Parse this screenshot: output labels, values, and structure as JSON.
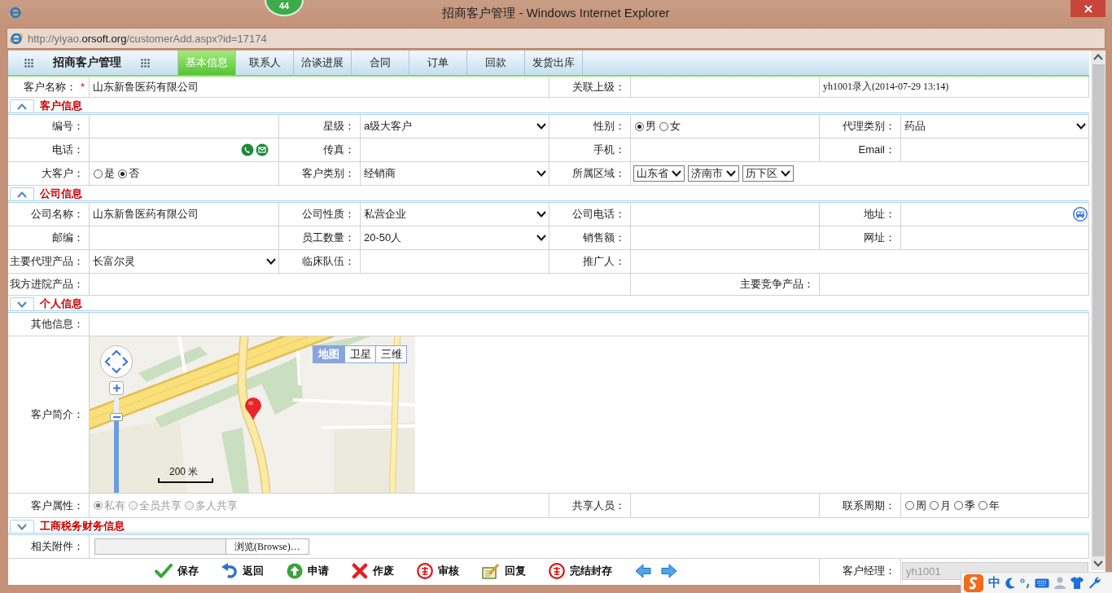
{
  "window": {
    "title": "招商客户管理 - Windows Internet Explorer",
    "badge": "44"
  },
  "address_bar": {
    "url": "http://yiyao.**orsoft.org**/customerAdd.aspx?id=17174"
  },
  "app_bar": {
    "title": "招商客户管理",
    "tabs": [
      {
        "label": "基本信息",
        "selected": true
      },
      {
        "label": "联系人",
        "selected": false
      },
      {
        "label": "洽谈进展",
        "selected": false
      },
      {
        "label": "合同",
        "selected": false
      },
      {
        "label": "订单",
        "selected": false
      },
      {
        "label": "回款",
        "selected": false
      },
      {
        "label": "发货出库",
        "selected": false
      }
    ]
  },
  "form": [
    {
      "kind": "headline",
      "cells": [
        {
          "kind": "label",
          "text": "客户名称：",
          "mark": "*"
        },
        {
          "kind": "text",
          "value": "山东新鲁医药有限公司"
        },
        {
          "kind": "label",
          "text": "关联上级："
        },
        {
          "kind": "text"
        },
        {
          "kind": "note",
          "text": "yh1001录入(2014-07-29 13:14)"
        }
      ]
    },
    {
      "kind": "section",
      "title": "客户信息",
      "expanded": true
    },
    {
      "kind": "standard",
      "cells": [
        {
          "kind": "label",
          "text": "编号："
        },
        {
          "kind": "text"
        },
        {
          "kind": "label",
          "text": "星级："
        },
        {
          "kind": "select",
          "value": "a级大客户"
        },
        {
          "kind": "label",
          "text": "性别："
        },
        {
          "kind": "radios",
          "disabled": false,
          "options": [
            {
              "label": "男",
              "selected": true
            },
            {
              "label": "女",
              "selected": false
            }
          ]
        },
        {
          "kind": "label",
          "text": "代理类别："
        },
        {
          "kind": "select",
          "value": "药品"
        }
      ]
    },
    {
      "kind": "standard",
      "cells": [
        {
          "kind": "label",
          "text": "电话："
        },
        {
          "kind": "contact"
        },
        {
          "kind": "label",
          "text": "传真："
        },
        {
          "kind": "text"
        },
        {
          "kind": "label",
          "text": "手机："
        },
        {
          "kind": "text"
        },
        {
          "kind": "label",
          "text": "Email："
        },
        {
          "kind": "text"
        }
      ]
    },
    {
      "kind": "standard",
      "cells": [
        {
          "kind": "label",
          "text": "大客户："
        },
        {
          "kind": "radios",
          "disabled": false,
          "options": [
            {
              "label": "是",
              "selected": false
            },
            {
              "label": "否",
              "selected": true
            }
          ]
        },
        {
          "kind": "label",
          "text": "客户类别："
        },
        {
          "kind": "select",
          "value": "经销商"
        },
        {
          "kind": "label",
          "text": "所属区域："
        },
        {
          "kind": "region",
          "selects": [
            "山东省",
            "济南市",
            "历下区"
          ]
        }
      ]
    },
    {
      "kind": "section",
      "title": "公司信息",
      "expanded": true
    },
    {
      "kind": "standard",
      "cells": [
        {
          "kind": "label",
          "text": "公司名称："
        },
        {
          "kind": "text",
          "value": "山东新鲁医药有限公司"
        },
        {
          "kind": "label",
          "text": "公司性质："
        },
        {
          "kind": "select",
          "value": "私营企业"
        },
        {
          "kind": "label",
          "text": "公司电话："
        },
        {
          "kind": "text"
        },
        {
          "kind": "label",
          "text": "地址："
        },
        {
          "kind": "address"
        }
      ]
    },
    {
      "kind": "standard",
      "cells": [
        {
          "kind": "label",
          "text": "邮编："
        },
        {
          "kind": "text"
        },
        {
          "kind": "label",
          "text": "员工数量："
        },
        {
          "kind": "select",
          "value": "20-50人"
        },
        {
          "kind": "label",
          "text": "销售额："
        },
        {
          "kind": "text"
        },
        {
          "kind": "label",
          "text": "网址："
        },
        {
          "kind": "text"
        }
      ]
    },
    {
      "kind": "standard",
      "cells": [
        {
          "kind": "label",
          "text": "主要代理产品："
        },
        {
          "kind": "select",
          "value": "长富尔灵"
        },
        {
          "kind": "label",
          "text": "临床队伍："
        },
        {
          "kind": "text"
        },
        {
          "kind": "label",
          "text": "推广人："
        },
        {
          "kind": "text"
        }
      ]
    },
    {
      "kind": "split",
      "cells": [
        {
          "kind": "label",
          "text": "我方进院产品："
        },
        {
          "kind": "text"
        },
        {
          "kind": "label",
          "text": "主要竞争产品："
        },
        {
          "kind": "text"
        }
      ]
    },
    {
      "kind": "section",
      "title": "个人信息",
      "expanded": false
    },
    {
      "kind": "standard",
      "cells": [
        {
          "kind": "label",
          "text": "其他信息："
        },
        {
          "kind": "text"
        }
      ]
    },
    {
      "kind": "standard",
      "cells": [
        {
          "kind": "label",
          "text": "客户简介："
        },
        {
          "kind": "map",
          "map_types": [
            {
              "label": "地图",
              "selected": true
            },
            {
              "label": "卫星",
              "selected": false
            },
            {
              "label": "三维",
              "selected": false
            }
          ],
          "zoom": {
            "level": 0.8
          },
          "scale": "200 米"
        }
      ]
    },
    {
      "kind": "property",
      "cells": [
        {
          "kind": "label",
          "text": "客户属性："
        },
        {
          "kind": "radios",
          "disabled": true,
          "options": [
            {
              "label": "私有",
              "selected": true
            },
            {
              "label": "全员共享",
              "selected": false
            },
            {
              "label": "多人共享",
              "selected": false
            }
          ]
        },
        {
          "kind": "label",
          "text": "共享人员："
        },
        {
          "kind": "text"
        },
        {
          "kind": "label",
          "text": "联系周期："
        },
        {
          "kind": "radios",
          "disabled": false,
          "options": [
            {
              "label": "周",
              "selected": false
            },
            {
              "label": "月",
              "selected": false
            },
            {
              "label": "季",
              "selected": false
            },
            {
              "label": "年",
              "selected": false
            }
          ]
        }
      ]
    },
    {
      "kind": "section",
      "title": "工商税务财务信息",
      "expanded": false
    },
    {
      "kind": "standard",
      "cells": [
        {
          "kind": "label",
          "text": "相关附件："
        },
        {
          "kind": "file",
          "button": "浏览(Browse)…"
        }
      ]
    }
  ],
  "actions": {
    "buttons": [
      {
        "kind": "save",
        "label": "保存"
      },
      {
        "kind": "back",
        "label": "返回"
      },
      {
        "kind": "apply",
        "label": "申请"
      },
      {
        "kind": "void",
        "label": "作废"
      },
      {
        "kind": "review",
        "label": "审核"
      },
      {
        "kind": "reply",
        "label": "回复"
      },
      {
        "kind": "archive",
        "label": "完结封存"
      },
      {
        "kind": "prev"
      },
      {
        "kind": "next"
      }
    ],
    "manager": {
      "label": "客户经理：",
      "value": "yh1001",
      "disabled": true
    }
  },
  "ime_toolbar": {
    "mode": "中"
  }
}
